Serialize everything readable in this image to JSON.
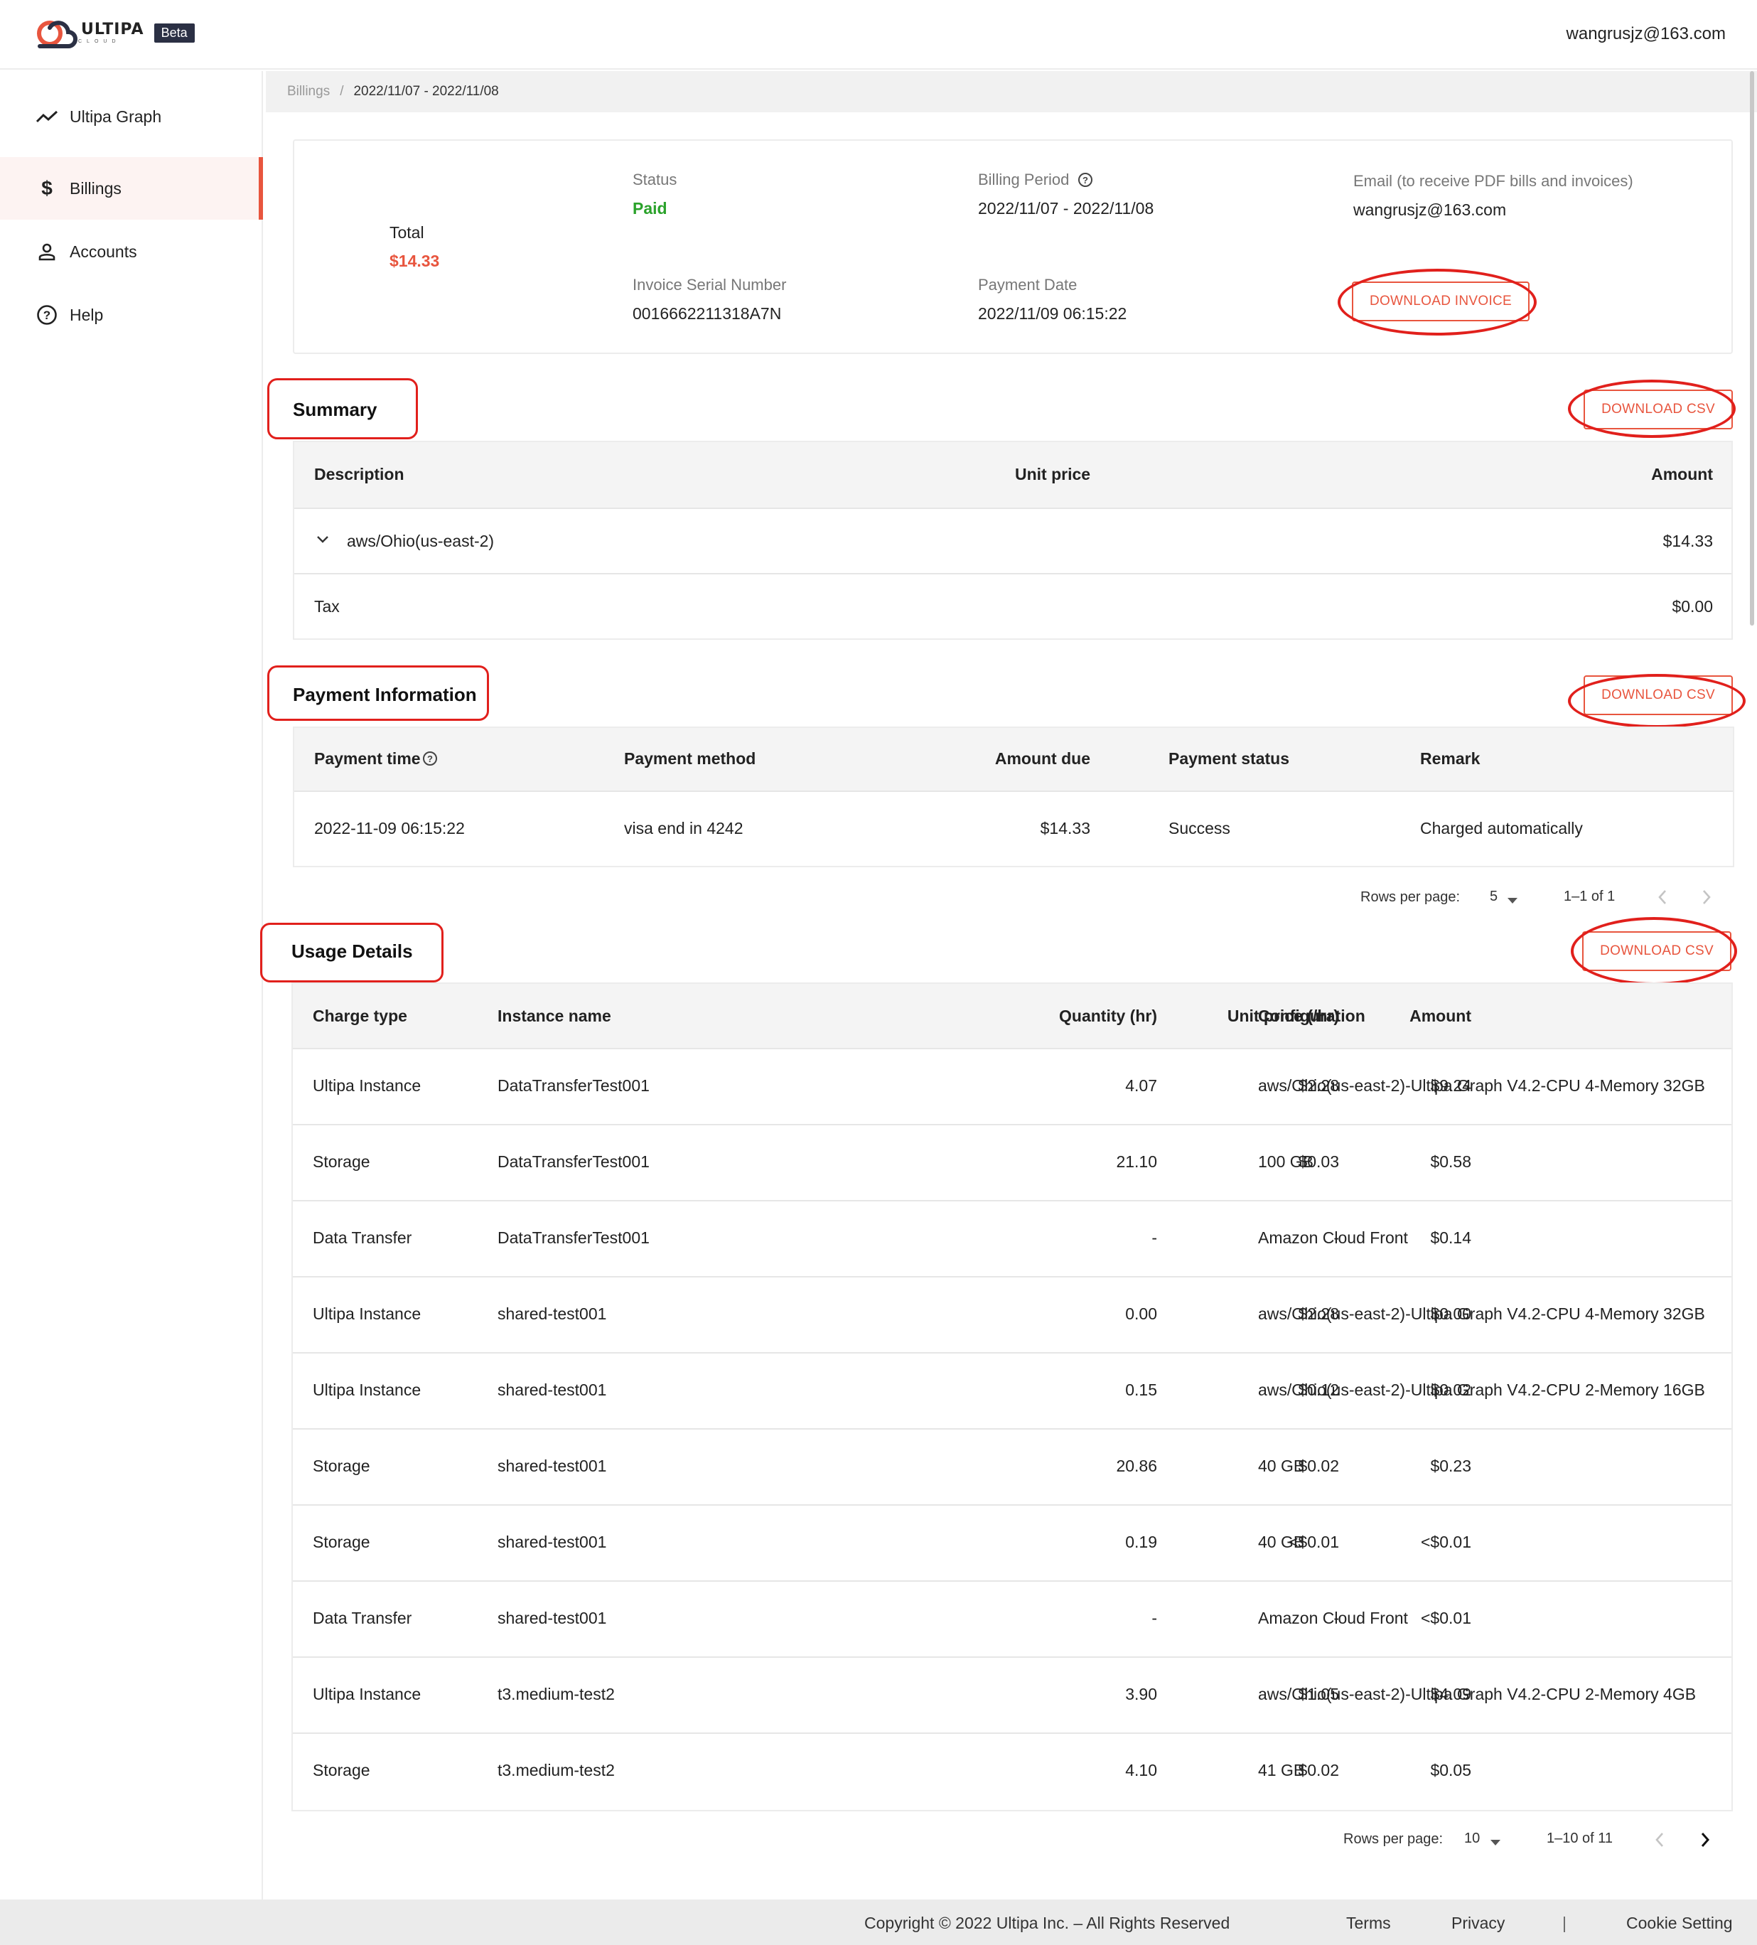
{
  "header": {
    "logo_word": "ULTIPA",
    "logo_sub": "CLOUD",
    "badge": "Beta",
    "user_email": "wangrusjz@163.com"
  },
  "sidebar": {
    "items": [
      {
        "label": "Ultipa Graph",
        "icon": "trend-icon",
        "active": false
      },
      {
        "label": "Billings",
        "icon": "dollar-icon",
        "active": true
      },
      {
        "label": "Accounts",
        "icon": "person-icon",
        "active": false
      },
      {
        "label": "Help",
        "icon": "help-circle-icon",
        "active": false
      }
    ]
  },
  "breadcrumb": {
    "parent": "Billings",
    "separator": "/",
    "current": "2022/11/07 - 2022/11/08"
  },
  "invoice": {
    "total_label": "Total",
    "total_value": "$14.33",
    "status_label": "Status",
    "status_value": "Paid",
    "period_label": "Billing Period",
    "period_value": "2022/11/07 - 2022/11/08",
    "email_label": "Email (to receive PDF bills and invoices)",
    "email_value": "wangrusjz@163.com",
    "serial_label": "Invoice Serial Number",
    "serial_value": "0016662211318A7N",
    "payment_date_label": "Payment Date",
    "payment_date_value": "2022/11/09 06:15:22",
    "download_invoice": "DOWNLOAD INVOICE"
  },
  "summary": {
    "title": "Summary",
    "download": "DOWNLOAD CSV",
    "headers": {
      "description": "Description",
      "unit_price": "Unit price",
      "amount": "Amount"
    },
    "rows": [
      {
        "description": "aws/Ohio(us-east-2)",
        "amount": "$14.33",
        "expandable": true
      },
      {
        "description": "Tax",
        "amount": "$0.00",
        "expandable": false
      }
    ]
  },
  "payment": {
    "title": "Payment Information",
    "download": "DOWNLOAD CSV",
    "headers": {
      "time": "Payment time",
      "method": "Payment method",
      "due": "Amount due",
      "status": "Payment status",
      "remark": "Remark"
    },
    "rows": [
      {
        "time": "2022-11-09 06:15:22",
        "method": "visa end in 4242",
        "due": "$14.33",
        "status": "Success",
        "remark": "Charged automatically"
      }
    ],
    "pager": {
      "rows_label": "Rows per page:",
      "rows_value": "5",
      "range": "1–1 of 1"
    }
  },
  "usage": {
    "title": "Usage Details",
    "download": "DOWNLOAD CSV",
    "headers": {
      "charge_type": "Charge type",
      "instance": "Instance name",
      "quantity": "Quantity (hr)",
      "unit_price": "Unit price (/hr)",
      "amount": "Amount",
      "configuration": "Configuration"
    },
    "rows": [
      {
        "charge_type": "Ultipa Instance",
        "instance": "DataTransferTest001",
        "quantity": "4.07",
        "unit_price": "$2.28",
        "amount": "$9.24",
        "configuration": "aws/Ohio(us-east-2)-Ultipa Graph V4.2-CPU 4-Memory 32GB"
      },
      {
        "charge_type": "Storage",
        "instance": "DataTransferTest001",
        "quantity": "21.10",
        "unit_price": "$0.03",
        "amount": "$0.58",
        "configuration": "100 GB"
      },
      {
        "charge_type": "Data Transfer",
        "instance": "DataTransferTest001",
        "quantity": "-",
        "unit_price": "-",
        "amount": "$0.14",
        "configuration": "Amazon Cloud Front"
      },
      {
        "charge_type": "Ultipa Instance",
        "instance": "shared-test001",
        "quantity": "0.00",
        "unit_price": "$2.28",
        "amount": "$0.00",
        "configuration": "aws/Ohio(us-east-2)-Ultipa Graph V4.2-CPU 4-Memory 32GB"
      },
      {
        "charge_type": "Ultipa Instance",
        "instance": "shared-test001",
        "quantity": "0.15",
        "unit_price": "$0.12",
        "amount": "$0.02",
        "configuration": "aws/Ohio(us-east-2)-Ultipa Graph V4.2-CPU 2-Memory 16GB"
      },
      {
        "charge_type": "Storage",
        "instance": "shared-test001",
        "quantity": "20.86",
        "unit_price": "$0.02",
        "amount": "$0.23",
        "configuration": "40 GB"
      },
      {
        "charge_type": "Storage",
        "instance": "shared-test001",
        "quantity": "0.19",
        "unit_price": "<$0.01",
        "amount": "<$0.01",
        "configuration": "40 GB"
      },
      {
        "charge_type": "Data Transfer",
        "instance": "shared-test001",
        "quantity": "-",
        "unit_price": "-",
        "amount": "<$0.01",
        "configuration": "Amazon Cloud Front"
      },
      {
        "charge_type": "Ultipa Instance",
        "instance": "t3.medium-test2",
        "quantity": "3.90",
        "unit_price": "$1.05",
        "amount": "$4.09",
        "configuration": "aws/Ohio(us-east-2)-Ultipa Graph V4.2-CPU 2-Memory 4GB"
      },
      {
        "charge_type": "Storage",
        "instance": "t3.medium-test2",
        "quantity": "4.10",
        "unit_price": "$0.02",
        "amount": "$0.05",
        "configuration": "41 GB"
      }
    ],
    "pager": {
      "rows_label": "Rows per page:",
      "rows_value": "10",
      "range": "1–10 of 11"
    }
  },
  "footer": {
    "copyright": "Copyright © 2022 Ultipa Inc. – All Rights Reserved",
    "terms": "Terms",
    "privacy": "Privacy",
    "divider": "|",
    "cookie": "Cookie Setting"
  },
  "colors": {
    "accent": "#e8553e",
    "paid": "#2aa22a",
    "annotation": "#e1201c"
  }
}
